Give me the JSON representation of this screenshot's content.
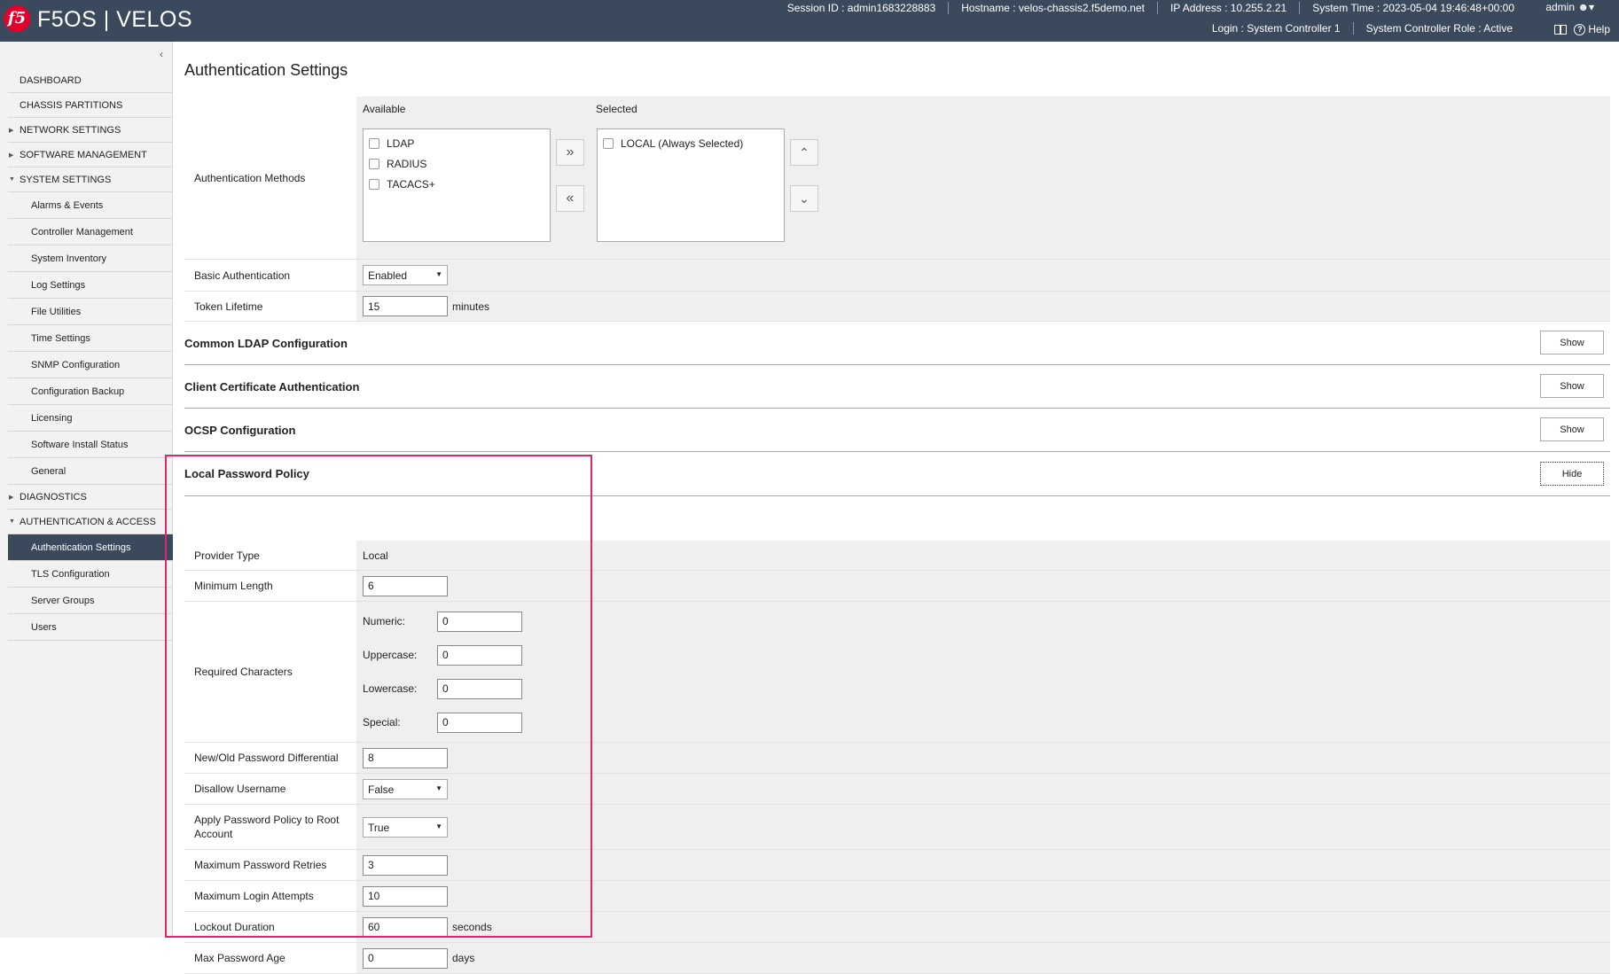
{
  "header": {
    "logo": "f5",
    "brand": "F5OS | VELOS",
    "session_id": "Session ID : admin1683228883",
    "hostname": "Hostname : velos-chassis2.f5demo.net",
    "ip_address": "IP Address : 10.255.2.21",
    "system_time": "System Time : 2023-05-04 19:46:48+00:00",
    "user": "admin",
    "login": "Login : System Controller 1",
    "role": "System Controller Role : Active",
    "help": "Help"
  },
  "sidebar": {
    "items": [
      {
        "type": "sec",
        "label": "DASHBOARD",
        "arrow": ""
      },
      {
        "type": "sec",
        "label": "CHASSIS PARTITIONS",
        "arrow": ""
      },
      {
        "type": "sec",
        "label": "NETWORK SETTINGS",
        "arrow": "▶"
      },
      {
        "type": "sec",
        "label": "SOFTWARE MANAGEMENT",
        "arrow": "▶"
      },
      {
        "type": "sec",
        "label": "SYSTEM SETTINGS",
        "arrow": "▼"
      },
      {
        "type": "sub",
        "label": "Alarms & Events"
      },
      {
        "type": "sub",
        "label": "Controller Management"
      },
      {
        "type": "sub",
        "label": "System Inventory"
      },
      {
        "type": "sub",
        "label": "Log Settings"
      },
      {
        "type": "sub",
        "label": "File Utilities"
      },
      {
        "type": "sub",
        "label": "Time Settings"
      },
      {
        "type": "sub",
        "label": "SNMP Configuration"
      },
      {
        "type": "sub",
        "label": "Configuration Backup"
      },
      {
        "type": "sub",
        "label": "Licensing"
      },
      {
        "type": "sub",
        "label": "Software Install Status"
      },
      {
        "type": "sub",
        "label": "General"
      },
      {
        "type": "sec",
        "label": "DIAGNOSTICS",
        "arrow": "▶"
      },
      {
        "type": "sec",
        "label": "AUTHENTICATION & ACCESS",
        "arrow": "▼"
      },
      {
        "type": "sub",
        "label": "Authentication Settings",
        "active": true
      },
      {
        "type": "sub",
        "label": "TLS Configuration"
      },
      {
        "type": "sub",
        "label": "Server Groups"
      },
      {
        "type": "sub",
        "label": "Users"
      }
    ]
  },
  "page": {
    "title": "Authentication Settings"
  },
  "auth_methods": {
    "label": "Authentication Methods",
    "available_title": "Available",
    "selected_title": "Selected",
    "available": [
      "LDAP",
      "RADIUS",
      "TACACS+"
    ],
    "selected": [
      "LOCAL (Always Selected)"
    ],
    "add_glyph": "»",
    "remove_glyph": "«",
    "up_glyph": "⌃",
    "down_glyph": "⌄"
  },
  "basic_auth": {
    "label": "Basic Authentication",
    "value": "Enabled"
  },
  "token_lifetime": {
    "label": "Token Lifetime",
    "value": "15",
    "unit": "minutes"
  },
  "sections": {
    "ldap": {
      "title": "Common LDAP Configuration",
      "button": "Show"
    },
    "cert": {
      "title": "Client Certificate Authentication",
      "button": "Show"
    },
    "ocsp": {
      "title": "OCSP Configuration",
      "button": "Show"
    },
    "lpp": {
      "title": "Local Password Policy",
      "button": "Hide"
    }
  },
  "policy": {
    "provider_type": {
      "label": "Provider Type",
      "value": "Local"
    },
    "min_length": {
      "label": "Minimum Length",
      "value": "6"
    },
    "required": {
      "label": "Required Characters",
      "numeric_label": "Numeric:",
      "numeric": "0",
      "upper_label": "Uppercase:",
      "upper": "0",
      "lower_label": "Lowercase:",
      "lower": "0",
      "special_label": "Special:",
      "special": "0"
    },
    "differential": {
      "label": "New/Old Password Differential",
      "value": "8"
    },
    "disallow_username": {
      "label": "Disallow Username",
      "value": "False"
    },
    "apply_root": {
      "label": "Apply Password Policy to Root Account",
      "value": "True"
    },
    "max_retries": {
      "label": "Maximum Password Retries",
      "value": "3"
    },
    "max_login": {
      "label": "Maximum Login Attempts",
      "value": "10"
    },
    "lockout": {
      "label": "Lockout Duration",
      "value": "60",
      "unit": "seconds"
    },
    "max_age": {
      "label": "Max Password Age",
      "value": "0",
      "unit": "days"
    }
  }
}
